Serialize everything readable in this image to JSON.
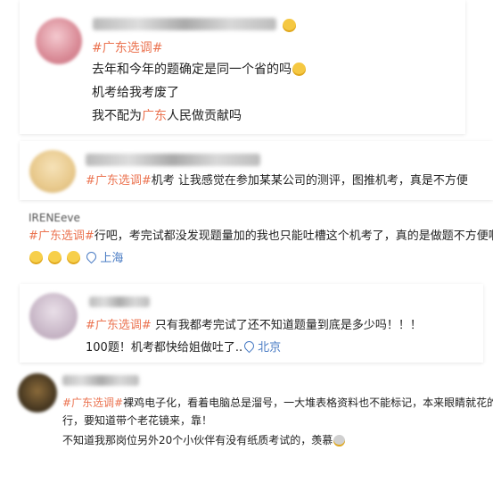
{
  "post1": {
    "tag": "#广东选调#",
    "line1": "去年和今年的题确定是同一个省的吗",
    "line2": "机考给我考废了",
    "line3_a": "我不配为",
    "line3_hl": "广东",
    "line3_b": "人民做贡献吗"
  },
  "post2": {
    "tag": "#广东选调#",
    "text": "机考 让我感觉在参加某某公司的测评，图推机考，真是不方便"
  },
  "post3": {
    "user": "IRENEeve",
    "tag": "#广东选调#",
    "text": "行吧，考完试都没发现题量加的我也只能吐槽这个机考了，真的是做题不方便啊",
    "location": "上海"
  },
  "post4": {
    "tag": "#广东选调#",
    "line1": " 只有我都考完试了还不知道题量到底是多少吗！！！",
    "line2": "100题！机考都快给姐做吐了..",
    "location": "北京"
  },
  "post5": {
    "tag": "#广东选调#",
    "line1": "裸鸡电子化，看着电脑总是溜号，一大堆表格资料也不能标记，本来眼睛就花的不",
    "line2": "行，要知道带个老花镜来，靠！",
    "line3": "不知道我那岗位另外20个小伙伴有没有纸质考试的，羡慕"
  }
}
